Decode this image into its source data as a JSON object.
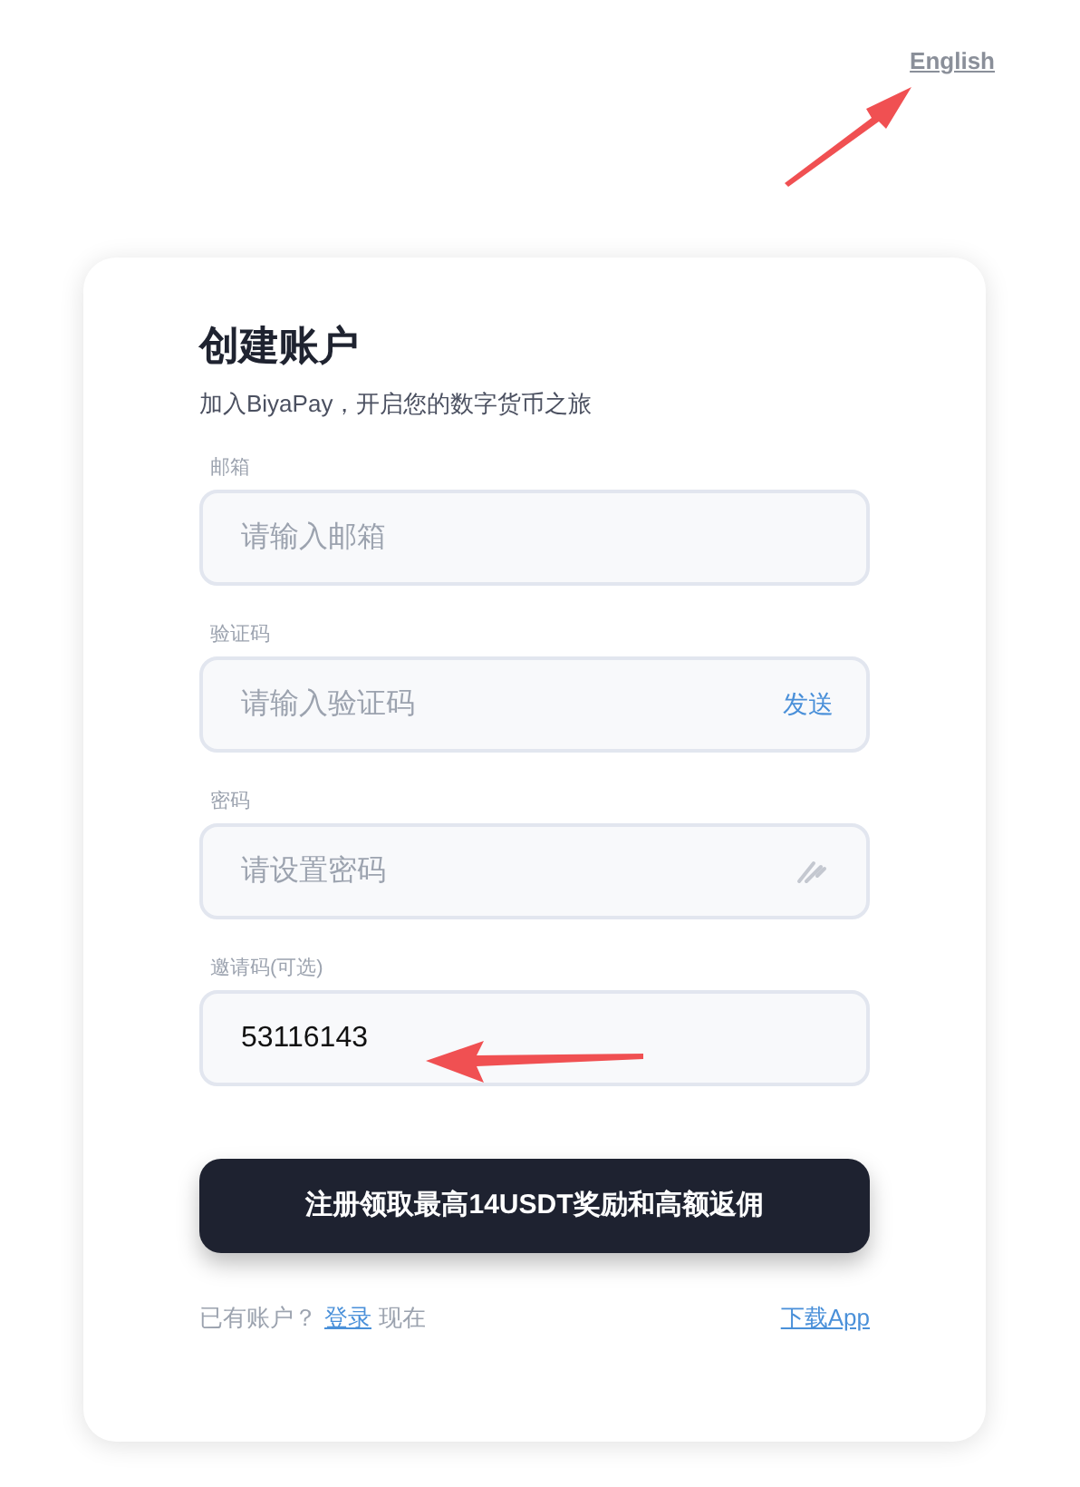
{
  "language_link": "English",
  "card": {
    "title": "创建账户",
    "subtitle": "加入BiyaPay，开启您的数字货币之旅",
    "fields": [
      {
        "kind": "plain",
        "label": "邮箱",
        "placeholder": "请输入邮箱"
      },
      {
        "kind": "send",
        "label": "验证码",
        "placeholder": "请输入验证码",
        "action": "发送"
      },
      {
        "kind": "password",
        "label": "密码",
        "placeholder": "请设置密码"
      },
      {
        "kind": "plain",
        "label": "邀请码(可选)",
        "value": "53116143"
      }
    ],
    "submit": "注册领取最高14USDT奖励和高额返佣",
    "footer": {
      "prompt": "已有账户？",
      "login": "登录",
      "suffix": "现在",
      "download": "下载App"
    }
  }
}
